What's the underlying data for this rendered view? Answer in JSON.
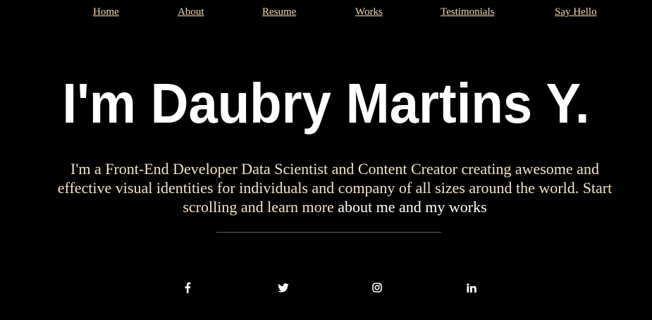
{
  "nav": {
    "items": [
      {
        "label": "Home"
      },
      {
        "label": "About"
      },
      {
        "label": "Resume"
      },
      {
        "label": "Works"
      },
      {
        "label": "Testimonials"
      },
      {
        "label": "Say Hello"
      }
    ],
    "link_color": "#f3d9b1"
  },
  "hero": {
    "headline": "I'm Daubry Martins Y.",
    "intro_parts": [
      "I'm a Front-End Developer Data Scientist and Content Creator creating awesome and effective visual identities for individuals and company of all sizes around the world. Start scrolling and learn more",
      " about me and my works"
    ]
  },
  "social": {
    "icons": [
      "facebook-icon",
      "twitter-icon",
      "instagram-icon",
      "linkedin-icon"
    ]
  },
  "colors": {
    "background": "#000000",
    "headline": "#ffffff",
    "intro_text": "#f3e3c8",
    "divider": "#5f5f5f"
  }
}
